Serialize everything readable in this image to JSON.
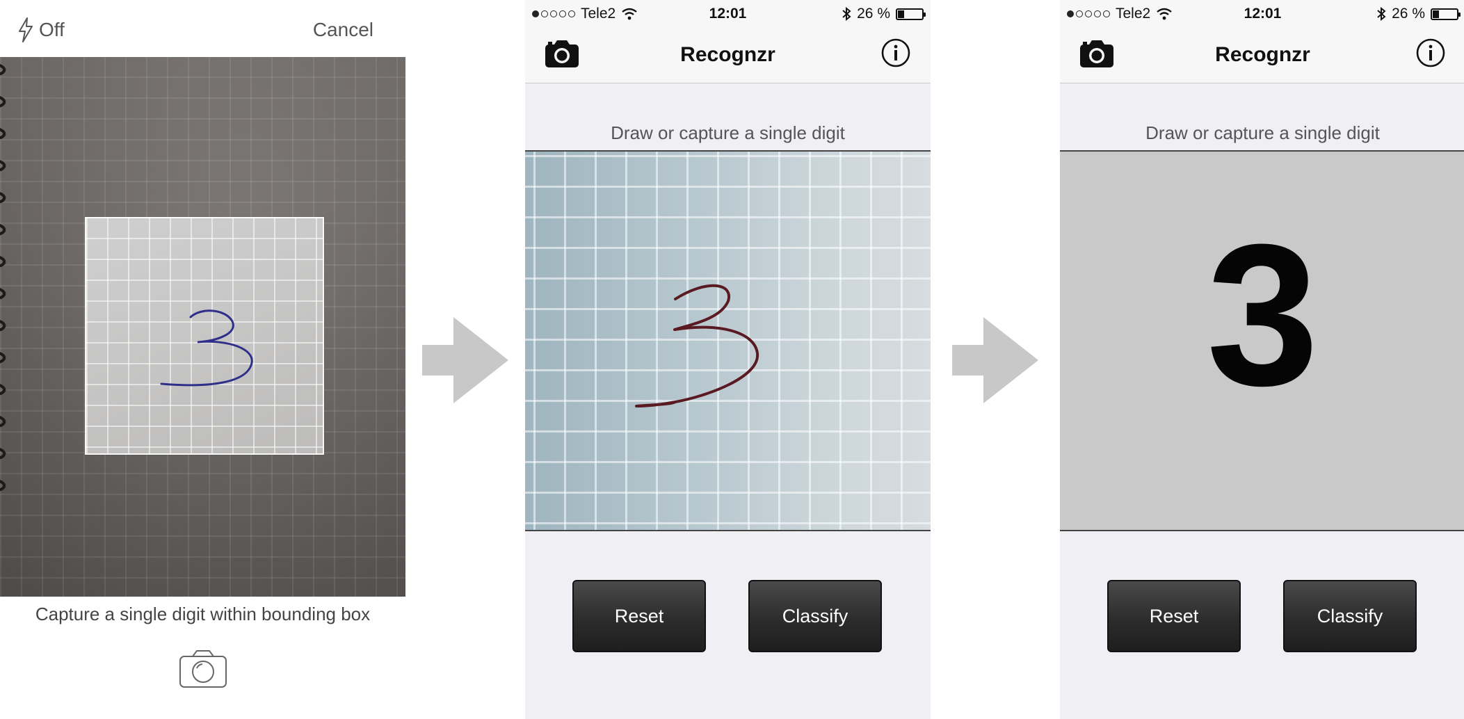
{
  "panel1": {
    "flash_label": "Off",
    "cancel_label": "Cancel",
    "caption": "Capture a single digit within bounding box",
    "captured_digit": "3",
    "icons": {
      "flash": "lightning-icon",
      "shutter": "camera-shutter-icon"
    }
  },
  "arrows": [
    "arrow-right-icon",
    "arrow-right-icon"
  ],
  "screens": [
    {
      "status": {
        "carrier": "Tele2",
        "time": "12:01",
        "battery_text": "26 %",
        "battery_level": 0.26
      },
      "nav": {
        "title": "Recognzr"
      },
      "prompt": "Draw or capture a single digit",
      "canvas_digit": "3",
      "buttons": {
        "reset": "Reset",
        "classify": "Classify"
      }
    },
    {
      "status": {
        "carrier": "Tele2",
        "time": "12:01",
        "battery_text": "26 %",
        "battery_level": 0.26
      },
      "nav": {
        "title": "Recognzr"
      },
      "prompt": "Draw or capture a single digit",
      "canvas_digit": "3",
      "buttons": {
        "reset": "Reset",
        "classify": "Classify"
      }
    }
  ],
  "colors": {
    "arrow": "#c8c8c8",
    "button": "#2c2c2c",
    "ink_blue": "#2f2f8a",
    "ink_red": "#5a1a22"
  }
}
